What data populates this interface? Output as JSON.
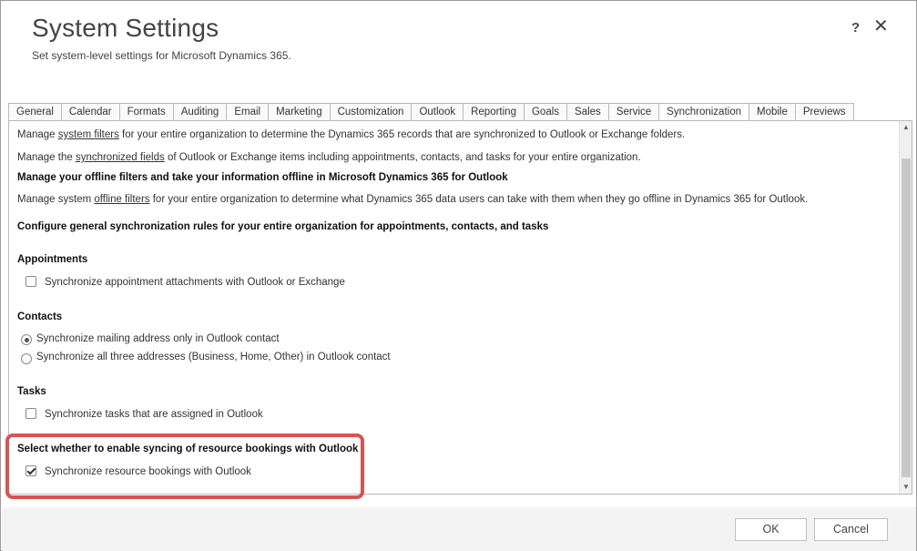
{
  "dialog": {
    "title": "System Settings",
    "subtitle": "Set system-level settings for Microsoft Dynamics 365.",
    "help_glyph": "?",
    "close_glyph": "✕"
  },
  "tabs": [
    {
      "label": "General"
    },
    {
      "label": "Calendar"
    },
    {
      "label": "Formats"
    },
    {
      "label": "Auditing"
    },
    {
      "label": "Email"
    },
    {
      "label": "Marketing"
    },
    {
      "label": "Customization"
    },
    {
      "label": "Outlook"
    },
    {
      "label": "Reporting"
    },
    {
      "label": "Goals"
    },
    {
      "label": "Sales"
    },
    {
      "label": "Service"
    },
    {
      "label": "Synchronization",
      "active": true
    },
    {
      "label": "Mobile"
    },
    {
      "label": "Previews"
    }
  ],
  "content": {
    "filters_line": {
      "pre": "Manage ",
      "link": "system filters",
      "post": " for your entire organization to determine the Dynamics 365 records that are synchronized to Outlook or Exchange folders."
    },
    "fields_line": {
      "pre": "Manage the ",
      "link": "synchronized fields",
      "post": " of Outlook or Exchange items including appointments, contacts, and tasks for your entire organization."
    },
    "offline_heading": "Manage your offline filters and take your information offline in Microsoft Dynamics 365 for Outlook",
    "offline_line": {
      "pre": "Manage system ",
      "link": "offline filters",
      "post": " for your entire organization to determine what Dynamics 365 data users can take with them when they go offline in Dynamics 365 for Outlook."
    },
    "rules_heading": "Configure general synchronization rules for your entire organization for appointments, contacts, and tasks",
    "appointments": {
      "heading": "Appointments",
      "option": "Synchronize appointment attachments with Outlook or Exchange",
      "checked": false
    },
    "contacts": {
      "heading": "Contacts",
      "options": [
        {
          "label": "Synchronize mailing address only in Outlook contact",
          "selected": true
        },
        {
          "label": "Synchronize all three addresses (Business, Home, Other) in Outlook contact",
          "selected": false
        }
      ]
    },
    "tasks": {
      "heading": "Tasks",
      "option": "Synchronize tasks that are assigned in Outlook",
      "checked": false
    },
    "bookings": {
      "heading": "Select whether to enable syncing of resource bookings with Outlook",
      "option": "Synchronize resource bookings with Outlook",
      "checked": true
    }
  },
  "footer": {
    "ok_label": "OK",
    "cancel_label": "Cancel"
  },
  "colors": {
    "highlight": "#d9534f",
    "footer_bg": "#f3f3f3"
  }
}
